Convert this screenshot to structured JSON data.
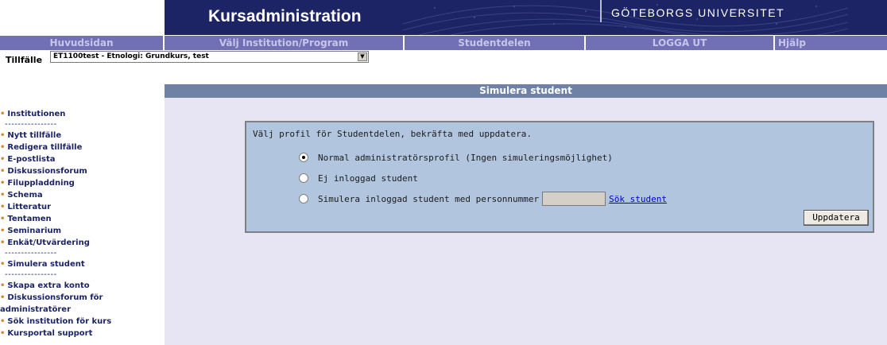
{
  "header": {
    "app_title": "Kursadministration",
    "university": "GÖTEBORGS UNIVERSITET",
    "banner_color": "#1c2466"
  },
  "nav": {
    "items": [
      {
        "label": "Huvudsidan"
      },
      {
        "label": "Välj Institution/Program"
      },
      {
        "label": "Studentdelen"
      },
      {
        "label": "LOGGA UT"
      },
      {
        "label": "Hjälp"
      }
    ],
    "bar_color": "#7170b5"
  },
  "tillfalle": {
    "label": "Tillfälle",
    "selected": "ET1100test - Etnologi: Grundkurs, test"
  },
  "sidemenu": {
    "items": [
      {
        "label": "Institutionen"
      },
      {
        "sep": "----------------"
      },
      {
        "label": "Nytt tillfälle"
      },
      {
        "label": "Redigera tillfälle"
      },
      {
        "label": "E-postlista"
      },
      {
        "label": "Diskussionsforum"
      },
      {
        "label": "Filuppladdning"
      },
      {
        "label": "Schema"
      },
      {
        "label": "Litteratur"
      },
      {
        "label": "Tentamen"
      },
      {
        "label": "Seminarium"
      },
      {
        "label": "Enkät/Utvärdering"
      },
      {
        "sep": "----------------"
      },
      {
        "label": "Simulera student"
      },
      {
        "sep": "----------------"
      },
      {
        "label": "Skapa extra konto"
      },
      {
        "label": "Diskussionsforum för administratörer"
      },
      {
        "label": "Sök institution för kurs"
      },
      {
        "label": "Kursportal support"
      }
    ]
  },
  "main": {
    "header": "Simulera student",
    "instruction": "Välj profil för Studentdelen, bekräfta med uppdatera.",
    "options": [
      {
        "label": "Normal administratörsprofil (Ingen simuleringsmöjlighet)",
        "checked": true
      },
      {
        "label": "Ej inloggad student",
        "checked": false
      },
      {
        "label": "Simulera inloggad student med personnummer",
        "checked": false
      }
    ],
    "pnr_value": "",
    "sok_student": "Sök student",
    "submit": "Uppdatera"
  }
}
